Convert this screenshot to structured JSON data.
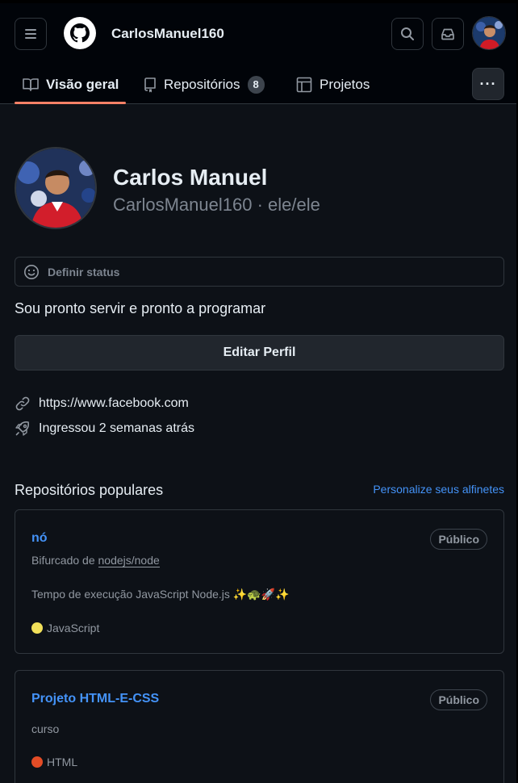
{
  "header": {
    "username": "CarlosManuel160",
    "icons": [
      "hamburger-icon",
      "github-logo",
      "search-icon",
      "inbox-icon",
      "avatar"
    ]
  },
  "tabs": [
    {
      "label": "Visão geral",
      "icon": "book-icon",
      "active": true
    },
    {
      "label": "Repositórios",
      "icon": "repo-icon",
      "count": "8"
    },
    {
      "label": "Projetos",
      "icon": "table-icon"
    }
  ],
  "more_label": "···",
  "profile": {
    "name": "Carlos Manuel",
    "login": "CarlosManuel160",
    "pronouns": "ele/ele",
    "separator": "·",
    "status_placeholder": "Definir status",
    "bio": "Sou pronto servir e pronto a programar",
    "edit_label": "Editar Perfil",
    "website": "https://www.facebook.com",
    "joined": "Ingressou 2 semanas atrás"
  },
  "popular": {
    "title": "Repositórios populares",
    "customize_link": "Personalize seus alfinetes",
    "repos": [
      {
        "name": "nó",
        "visibility": "Público",
        "forked_prefix": "Bifurcado de",
        "forked_from": "nodejs/node",
        "description": "Tempo de execução JavaScript Node.js ✨🐢🚀✨",
        "language": "JavaScript",
        "language_color": "#f1e05a"
      },
      {
        "name": "Projeto HTML-E-CSS",
        "visibility": "Público",
        "description": "curso",
        "language": "HTML",
        "language_color": "#e34c26"
      }
    ]
  },
  "colors": {
    "accent_tab": "#f78166",
    "link": "#4493f8",
    "background": "#0d1117",
    "header_bg": "#010409"
  }
}
